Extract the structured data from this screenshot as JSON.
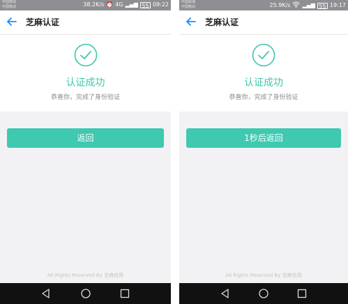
{
  "colors": {
    "accent": "#3ec7a9",
    "button": "#3ec9b0",
    "statusbar": "#8e8e93",
    "navbar": "#111111"
  },
  "left": {
    "status": {
      "carrier_line1": "中国移动",
      "carrier_line2": "中国移动",
      "speed": "38.2K/s",
      "network": "4G",
      "battery": "55",
      "time": "09:22"
    },
    "header": {
      "title": "芝麻认证"
    },
    "result": {
      "icon": "check-circle-icon",
      "title": "认证成功",
      "subtitle": "恭喜你，完成了身份验证"
    },
    "button_label": "返回",
    "footer": "All Rights Reserved By 芝麻信用"
  },
  "right": {
    "status": {
      "carrier_line1": "中国联通",
      "carrier_line2": "中国移动",
      "speed": "25.9K/s",
      "network": "wifi",
      "battery": "55",
      "time": "19:17"
    },
    "header": {
      "title": "芝麻认证"
    },
    "result": {
      "icon": "check-circle-icon",
      "title": "认证成功",
      "subtitle": "恭喜你，完成了身份验证"
    },
    "button_label": "1秒后返回",
    "footer": "All Rights Reserved By 芝麻信用"
  }
}
